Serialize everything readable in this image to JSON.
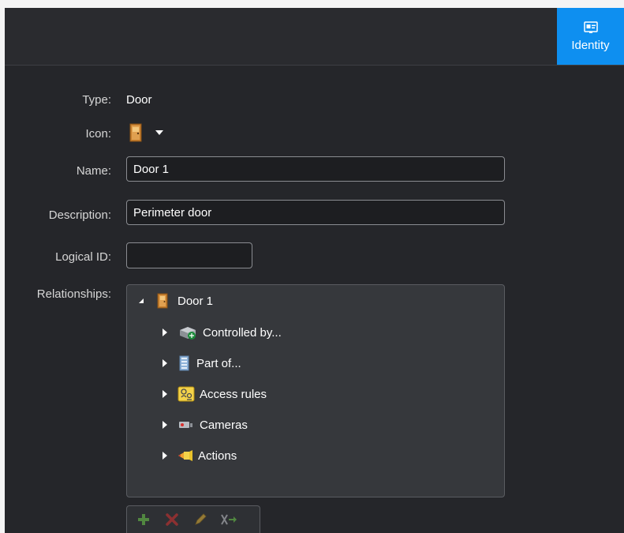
{
  "tabs": {
    "identity_label": "Identity"
  },
  "form": {
    "type_label": "Type:",
    "type_value": "Door",
    "icon_label": "Icon:",
    "icon_name": "door-icon",
    "name_label": "Name:",
    "name_value": "Door 1",
    "description_label": "Description:",
    "description_value": "Perimeter door",
    "logical_id_label": "Logical ID:",
    "logical_id_value": "",
    "relationships_label": "Relationships:"
  },
  "relationships": {
    "root": {
      "label": "Door 1",
      "icon": "door-icon",
      "expanded": true
    },
    "children": [
      {
        "label": "Controlled by...",
        "icon": "controller-icon"
      },
      {
        "label": "Part of...",
        "icon": "building-icon"
      },
      {
        "label": "Access rules",
        "icon": "access-rule-icon"
      },
      {
        "label": "Cameras",
        "icon": "camera-icon"
      },
      {
        "label": "Actions",
        "icon": "action-icon"
      }
    ],
    "toolbar": [
      "add-icon",
      "delete-icon",
      "edit-icon",
      "unlink-icon"
    ]
  },
  "colors": {
    "accent": "#0e8ff0",
    "background": "#25262a",
    "tree_bg": "#36383c"
  }
}
